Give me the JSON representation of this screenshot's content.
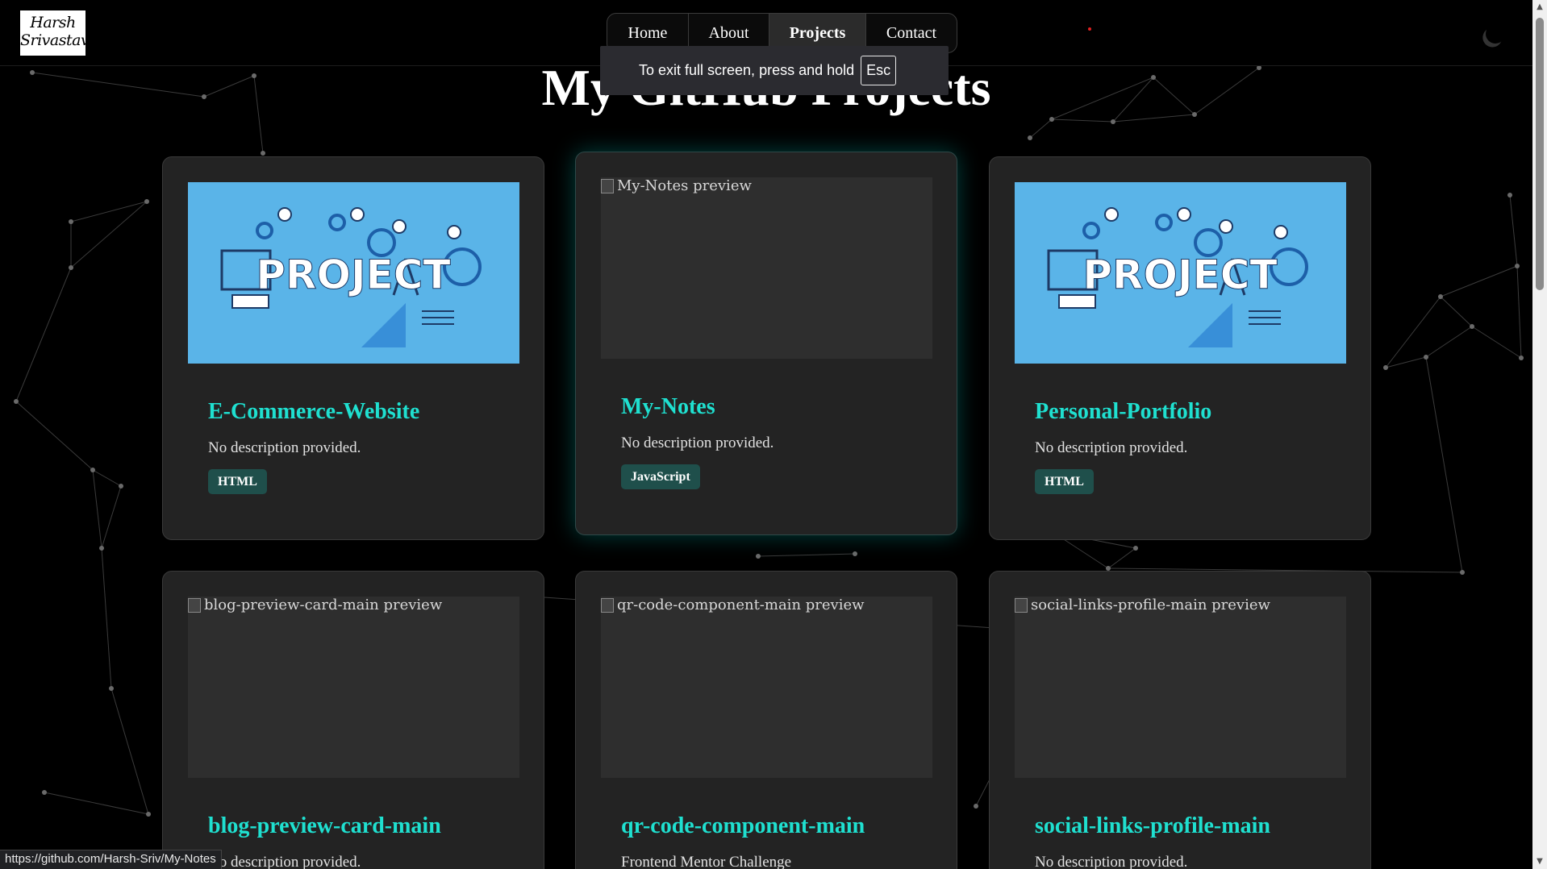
{
  "header": {
    "logo_line1": "Harsh",
    "logo_line2": "Srivastava",
    "nav": [
      {
        "label": "Home"
      },
      {
        "label": "About"
      },
      {
        "label": "Projects",
        "active": true
      },
      {
        "label": "Contact"
      }
    ],
    "theme_toggle_icon": "moon-icon"
  },
  "fullscreen_toast": {
    "message": "To exit full screen, press and hold",
    "key": "Esc"
  },
  "page_title": "My GitHub Projects",
  "projects": [
    {
      "title": "E-Commerce-Website",
      "description": "No description provided.",
      "language": "HTML",
      "image_alt": "",
      "image_loaded": true,
      "image_text": "PROJECT"
    },
    {
      "title": "My-Notes",
      "description": "No description provided.",
      "language": "JavaScript",
      "image_alt": "My-Notes preview",
      "image_loaded": false
    },
    {
      "title": "Personal-Portfolio",
      "description": "No description provided.",
      "language": "HTML",
      "image_alt": "",
      "image_loaded": true,
      "image_text": "PROJECT"
    },
    {
      "title": "blog-preview-card-main",
      "description": "No description provided.",
      "image_alt": "blog-preview-card-main preview",
      "image_loaded": false
    },
    {
      "title": "qr-code-component-main",
      "description": "Frontend Mentor Challenge",
      "image_alt": "qr-code-component-main preview",
      "image_loaded": false
    },
    {
      "title": "social-links-profile-main",
      "description": "No description provided.",
      "image_alt": "social-links-profile-main preview",
      "image_loaded": false
    }
  ],
  "status_bar": {
    "url": "https://github.com/Harsh-Sriv/My-Notes"
  },
  "colors": {
    "accent": "#1fe0d0",
    "tag_bg": "#1f4f4b",
    "card_bg": "#232323",
    "page_bg": "#000000",
    "project_image_bg": "#5ab4e8"
  }
}
